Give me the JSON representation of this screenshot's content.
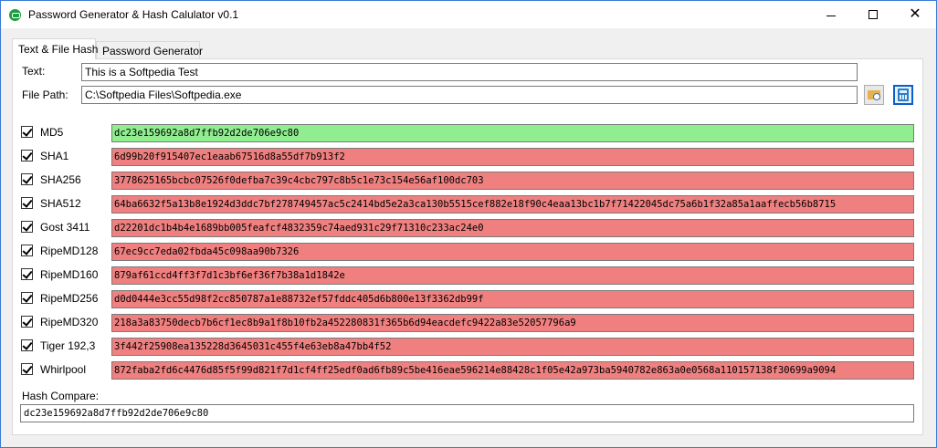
{
  "window": {
    "title": "Password Generator & Hash Calulator v0.1"
  },
  "tabs": [
    {
      "label": "Text & File Hash",
      "active": true
    },
    {
      "label": "Password Generator",
      "active": false
    }
  ],
  "inputs": {
    "text_label": "Text:",
    "text_value": "This is a Softpedia Test",
    "file_label": "File Path:",
    "file_value": "C:\\Softpedia Files\\Softpedia.exe"
  },
  "icons": {
    "browse": "folder-search-icon",
    "calculate": "calculator-icon"
  },
  "colors": {
    "match": "#90ee90",
    "mismatch": "#f08080"
  },
  "hashes": [
    {
      "name": "MD5",
      "checked": true,
      "value": "dc23e159692a8d7ffb92d2de706e9c80",
      "status": "match"
    },
    {
      "name": "SHA1",
      "checked": true,
      "value": "6d99b20f915407ec1eaab67516d8a55df7b913f2",
      "status": "mismatch"
    },
    {
      "name": "SHA256",
      "checked": true,
      "value": "3778625165bcbc07526f0defba7c39c4cbc797c8b5c1e73c154e56af100dc703",
      "status": "mismatch"
    },
    {
      "name": "SHA512",
      "checked": true,
      "value": "64ba6632f5a13b8e1924d3ddc7bf278749457ac5c2414bd5e2a3ca130b5515cef882e18f90c4eaa13bc1b7f71422045dc75a6b1f32a85a1aaffecb56b8715",
      "status": "mismatch"
    },
    {
      "name": "Gost 3411",
      "checked": true,
      "value": "d22201dc1b4b4e1689bb005feafcf4832359c74aed931c29f71310c233ac24e0",
      "status": "mismatch"
    },
    {
      "name": "RipeMD128",
      "checked": true,
      "value": "67ec9cc7eda02fbda45c098aa90b7326",
      "status": "mismatch"
    },
    {
      "name": "RipeMD160",
      "checked": true,
      "value": "879af61ccd4ff3f7d1c3bf6ef36f7b38a1d1842e",
      "status": "mismatch"
    },
    {
      "name": "RipeMD256",
      "checked": true,
      "value": "d0d0444e3cc55d98f2cc850787a1e88732ef57fddc405d6b800e13f3362db99f",
      "status": "mismatch"
    },
    {
      "name": "RipeMD320",
      "checked": true,
      "value": "218a3a83750decb7b6cf1ec8b9a1f8b10fb2a452280831f365b6d94eacdefc9422a83e52057796a9",
      "status": "mismatch"
    },
    {
      "name": "Tiger 192,3",
      "checked": true,
      "value": "3f442f25908ea135228d3645031c455f4e63eb8a47bb4f52",
      "status": "mismatch"
    },
    {
      "name": "Whirlpool",
      "checked": true,
      "value": "872faba2fd6c4476d85f5f99d821f7d1cf4ff25edf0ad6fb89c5be416eae596214e88428c1f05e42a973ba5940782e863a0e0568a110157138f30699a9094",
      "status": "mismatch"
    }
  ],
  "compare": {
    "label": "Hash Compare:",
    "value": "dc23e159692a8d7ffb92d2de706e9c80"
  }
}
